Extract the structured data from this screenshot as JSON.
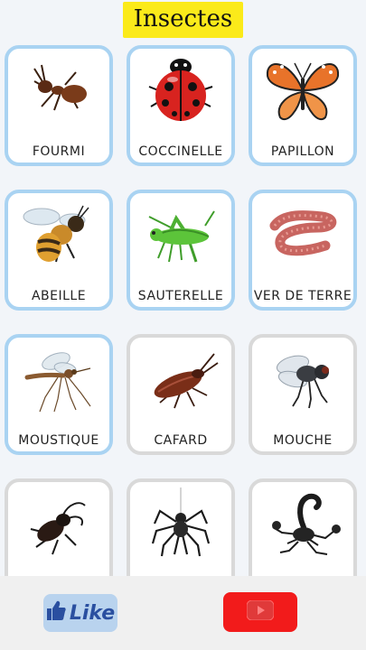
{
  "header": {
    "title": "Insectes"
  },
  "cards": [
    {
      "label": "FOURMI",
      "icon": "ant-icon"
    },
    {
      "label": "COCCINELLE",
      "icon": "ladybug-icon"
    },
    {
      "label": "PAPILLON",
      "icon": "butterfly-icon"
    },
    {
      "label": "ABEILLE",
      "icon": "bee-icon"
    },
    {
      "label": "SAUTERELLE",
      "icon": "grasshopper-icon"
    },
    {
      "label": "VER DE TERRE",
      "icon": "earthworm-icon"
    },
    {
      "label": "MOUSTIQUE",
      "icon": "mosquito-icon"
    },
    {
      "label": "CAFARD",
      "icon": "cockroach-icon"
    },
    {
      "label": "MOUCHE",
      "icon": "fly-icon"
    },
    {
      "label": "",
      "icon": "stag-beetle-icon"
    },
    {
      "label": "",
      "icon": "spider-icon"
    },
    {
      "label": "",
      "icon": "scorpion-icon"
    }
  ],
  "footer": {
    "like_label": "Like",
    "like_icon": "thumbs-up-icon",
    "youtube_icon": "youtube-play-icon"
  },
  "colors": {
    "title_bg": "#fbea1a",
    "card_border_blue": "#a9d3f2",
    "card_border_gray": "#d9d9d9",
    "youtube_red": "#f21b1b",
    "like_bg": "#b9d3ee"
  }
}
